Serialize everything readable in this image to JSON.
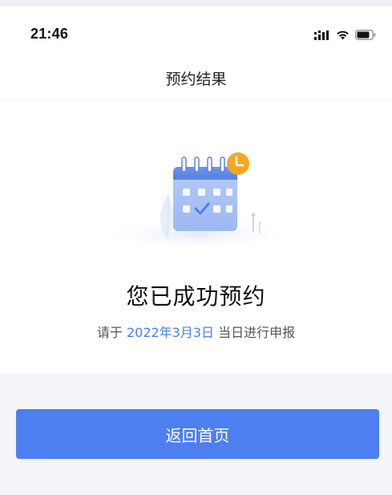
{
  "status_bar": {
    "time": "21:46",
    "icons": [
      "cellular-signal-icon",
      "wifi-icon",
      "battery-icon"
    ]
  },
  "nav": {
    "title": "预约结果"
  },
  "result": {
    "illustration_icon": "calendar-check-clock-icon",
    "title": "您已成功预约",
    "subtitle_prefix": "请于",
    "date": "2022年3月3日",
    "subtitle_suffix": "当日进行申报"
  },
  "actions": {
    "back_home_label": "返回首页"
  },
  "colors": {
    "accent": "#4d7ff1",
    "date_highlight": "#4a7ff0",
    "clock_badge": "#f5a623",
    "page_background": "#f4f5f8"
  }
}
